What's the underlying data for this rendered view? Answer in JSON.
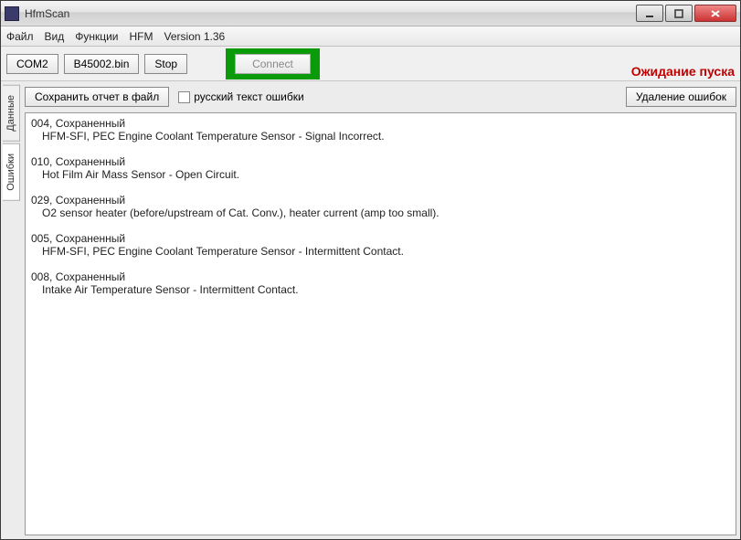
{
  "window": {
    "title": "HfmScan"
  },
  "menu": {
    "file": "Файл",
    "view": "Вид",
    "functions": "Функции",
    "hfm": "HFM",
    "version": "Version 1.36"
  },
  "toolbar": {
    "com": "COM2",
    "bin": "B45002.bin",
    "stop": "Stop",
    "connect": "Connect",
    "status": "Ожидание пуска"
  },
  "vtabs": {
    "data": "Данные",
    "errors": "Ошибки"
  },
  "toolrow": {
    "save_report": "Сохранить отчет в файл",
    "rus_text": "русский текст ошибки",
    "delete_errors": "Удаление ошибок"
  },
  "errors": [
    {
      "head": "004, Сохраненный",
      "desc": "HFM-SFI, PEC Engine Coolant Temperature Sensor - Signal Incorrect."
    },
    {
      "head": "010, Сохраненный",
      "desc": "Hot Film Air Mass Sensor - Open Circuit."
    },
    {
      "head": "029, Сохраненный",
      "desc": "O2 sensor heater (before/upstream of Cat. Conv.), heater current (amp too small)."
    },
    {
      "head": "005, Сохраненный",
      "desc": "HFM-SFI, PEC Engine Coolant Temperature Sensor - Intermittent Contact."
    },
    {
      "head": "008, Сохраненный",
      "desc": "Intake Air Temperature Sensor - Intermittent Contact."
    }
  ]
}
